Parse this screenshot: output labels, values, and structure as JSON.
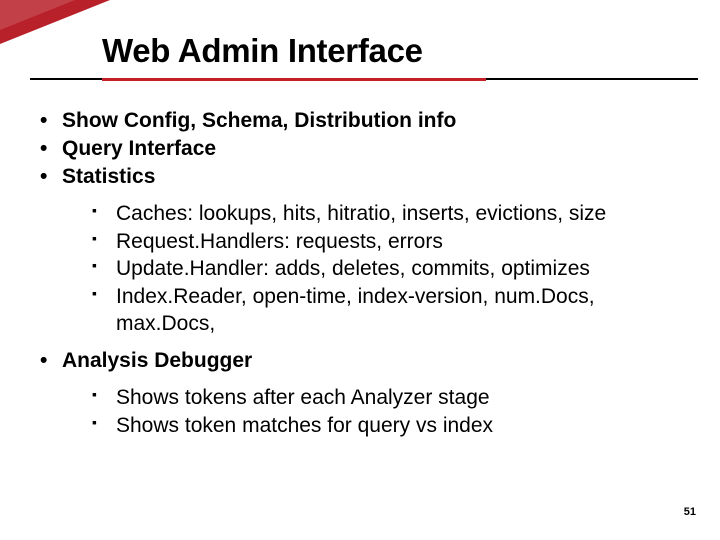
{
  "slide": {
    "title": "Web Admin Interface",
    "page_number": "51",
    "bullets": [
      {
        "text": "Show Config, Schema, Distribution info"
      },
      {
        "text": "Query Interface"
      },
      {
        "text": "Statistics",
        "sub": [
          "Caches: lookups, hits, hitratio, inserts, evictions, size",
          "Request.Handlers: requests, errors",
          "Update.Handler: adds, deletes, commits, optimizes",
          "Index.Reader, open-time, index-version, num.Docs, max.Docs,"
        ]
      },
      {
        "text": "Analysis Debugger",
        "sub": [
          "Shows tokens after each Analyzer stage",
          "Shows token matches for query vs index"
        ]
      }
    ]
  }
}
